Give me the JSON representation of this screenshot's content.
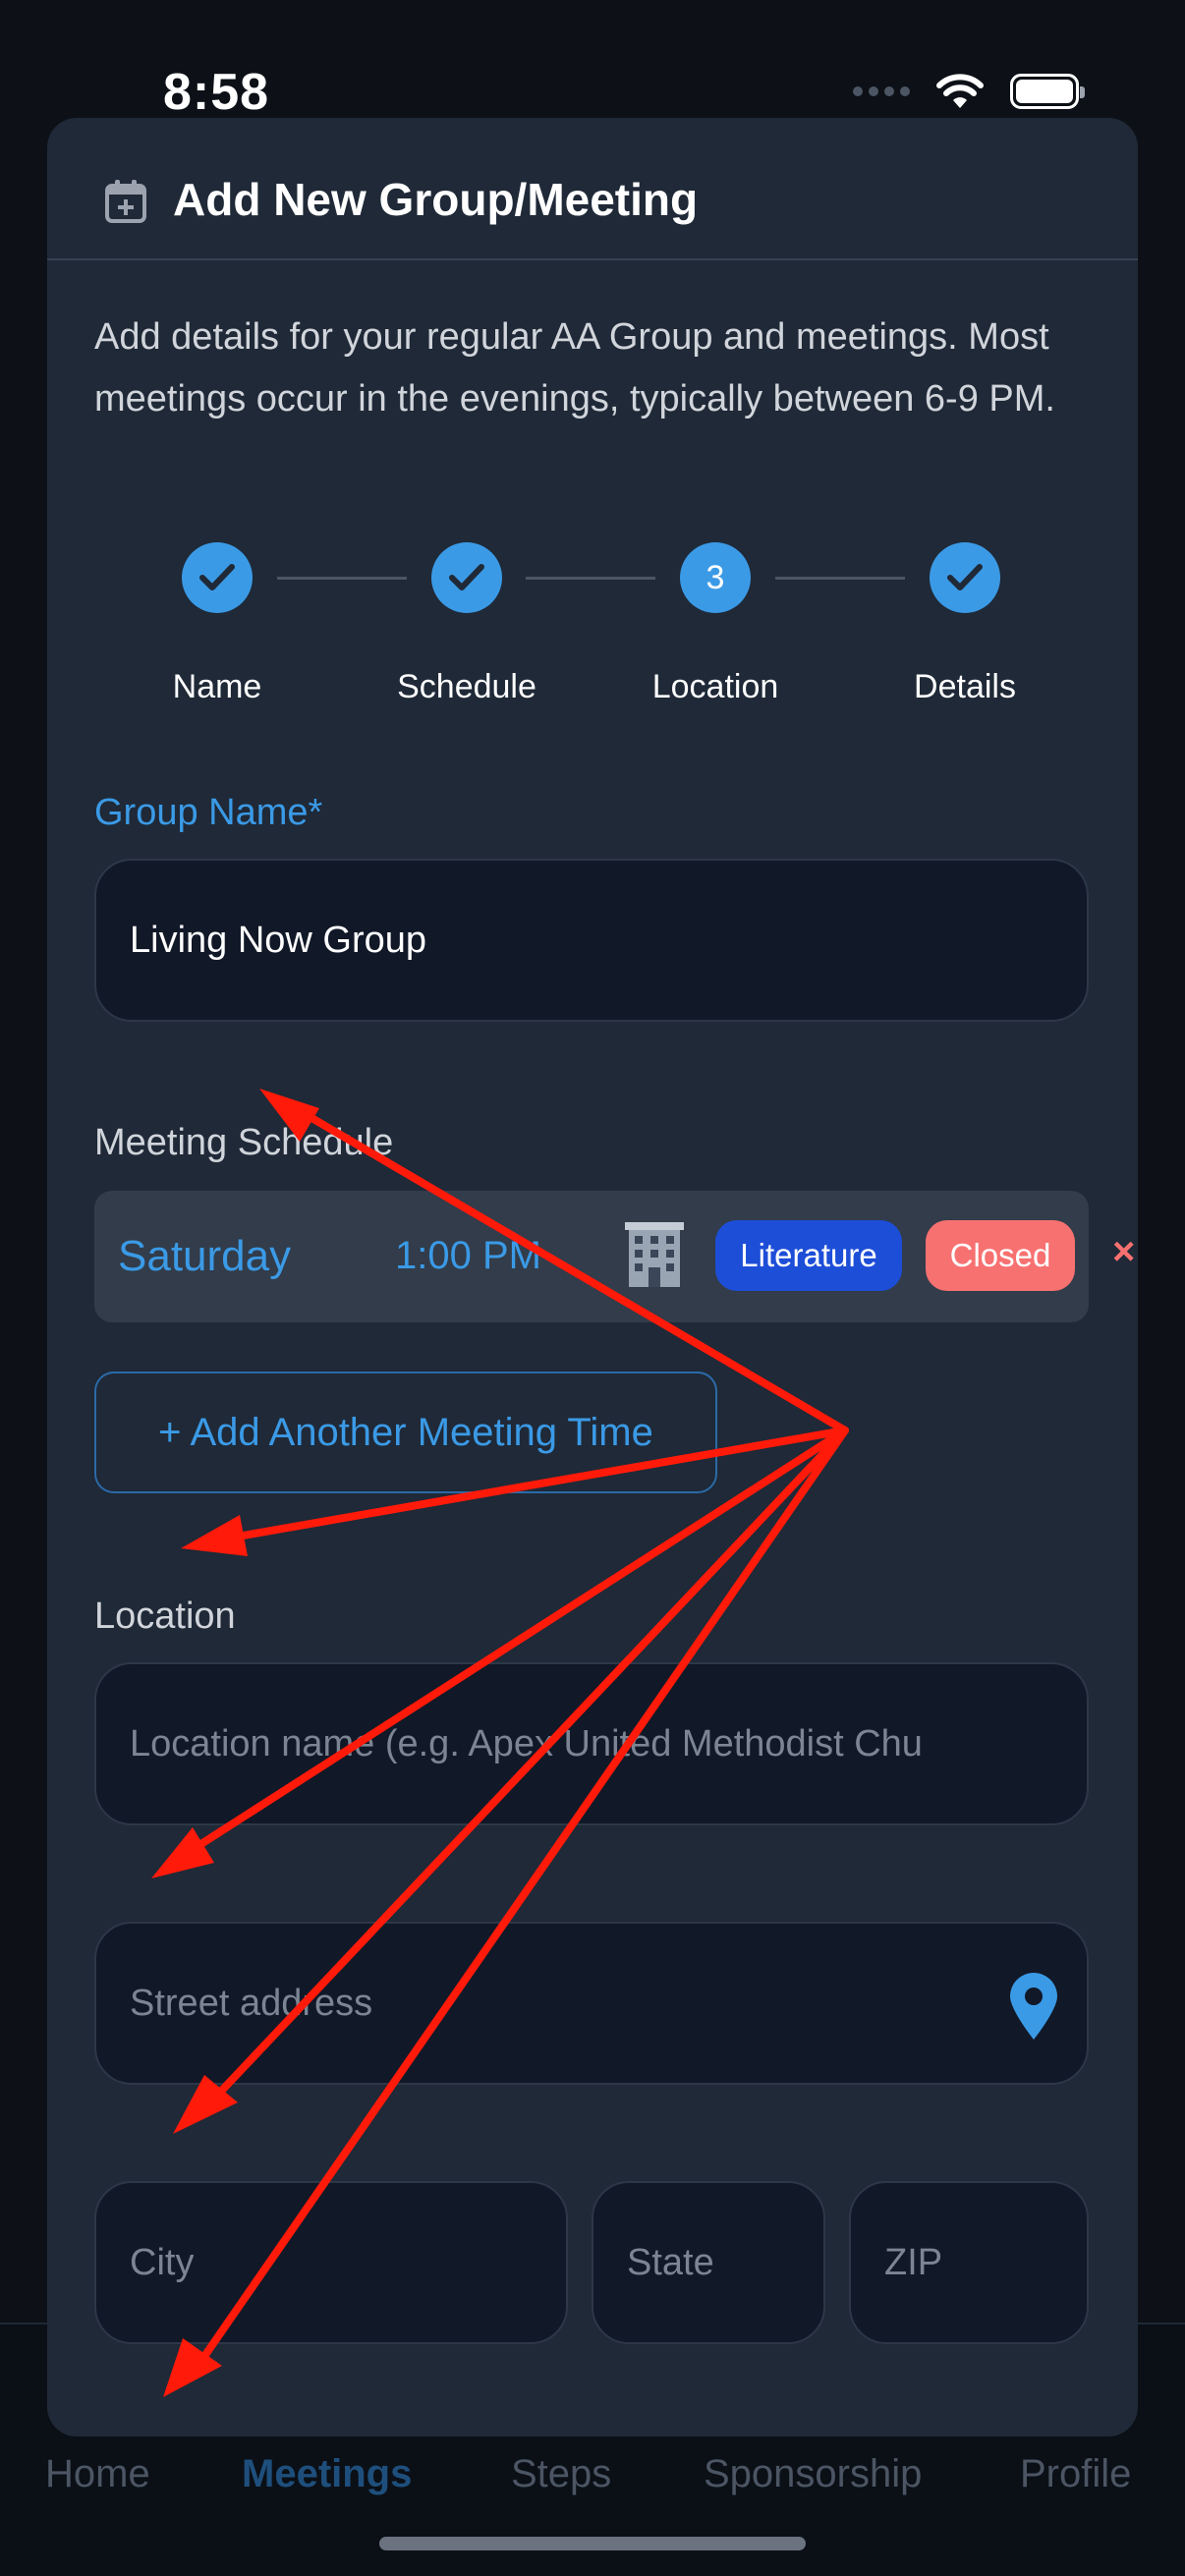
{
  "status": {
    "time": "8:58"
  },
  "modal": {
    "title": "Add New Group/Meeting",
    "intro": "Add details for your regular AA Group and meetings. Most meetings occur in the evenings, typically between 6-9 PM.",
    "steps": [
      {
        "label": "Name",
        "state": "done"
      },
      {
        "label": "Schedule",
        "state": "done"
      },
      {
        "label": "Location",
        "state": "current",
        "number": "3"
      },
      {
        "label": "Details",
        "state": "done"
      }
    ],
    "group_name": {
      "label": "Group Name*",
      "value": "Living Now Group"
    },
    "schedule": {
      "label": "Meeting Schedule",
      "entries": [
        {
          "day": "Saturday",
          "time": "1:00 PM",
          "icon": "building-icon",
          "tags": [
            "Literature",
            "Closed"
          ],
          "remove": "×"
        }
      ],
      "add_button": "+ Add Another Meeting Time"
    },
    "location": {
      "label": "Location",
      "name_placeholder": "Location name (e.g. Apex United Methodist Chu",
      "street_placeholder": "Street address",
      "city_placeholder": "City",
      "state_placeholder": "State",
      "zip_placeholder": "ZIP"
    }
  },
  "tabbar": {
    "items": [
      "Home",
      "Meetings",
      "Steps",
      "Sponsorship",
      "Profile"
    ],
    "active": "Meetings"
  },
  "colors": {
    "accent": "#3b9ae6",
    "closed": "#f87171",
    "literature": "#1d4ed8",
    "annotation": "#ff1a0a"
  }
}
